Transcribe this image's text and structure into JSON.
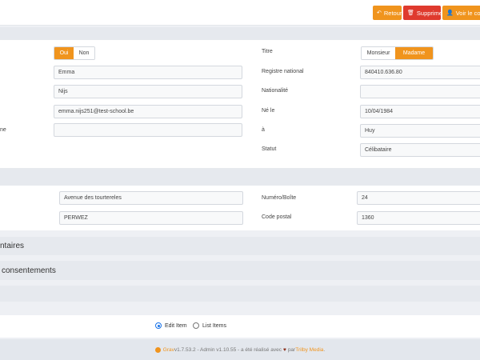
{
  "toolbar": {
    "back_label": "Retour",
    "delete_label": "Supprimer",
    "view_label": "Voir le compte"
  },
  "colors": {
    "accent": "#f0941d",
    "danger": "#df3a2e",
    "radio": "#1a73e8"
  },
  "personal": {
    "yes_label": "Oui",
    "no_label": "Non",
    "yes_selected": true,
    "first_name": "Emma",
    "last_name": "Nijs",
    "email": "emma.nijs251@test-school.be",
    "partial_label": "ne",
    "extra_field": "",
    "title_label": "Titre",
    "title_options": [
      "Monsieur",
      "Madame"
    ],
    "title_selected": "Madame",
    "registry_label": "Registre national",
    "registry_value": "840410.636.80",
    "nationality_label": "Nationalité",
    "nationality_value": "",
    "born_label": "Né le",
    "born_value": "10/04/1984",
    "place_label": "à",
    "place_value": "Huy",
    "status_label": "Statut",
    "status_value": "Célibataire"
  },
  "address": {
    "street_value": "Avenue des tourtereles",
    "city_value": "PERWEZ",
    "number_label": "Numéro/Boîte",
    "number_value": "24",
    "postal_label": "Code postal",
    "postal_value": "1360"
  },
  "sections": {
    "comments_title": "ntaires",
    "consents_title": "consentements"
  },
  "after_save": {
    "edit_item_label": "Edit Item",
    "list_items_label": "List Items",
    "selected": "Edit Item"
  },
  "footer": {
    "grav_link": "Grav",
    "grav_version": " v1.7.53.2 - Admin v1.10.55 - a été réalisé avec ",
    "par": " par ",
    "trilby_link": "Trilby Media",
    "end": "."
  }
}
